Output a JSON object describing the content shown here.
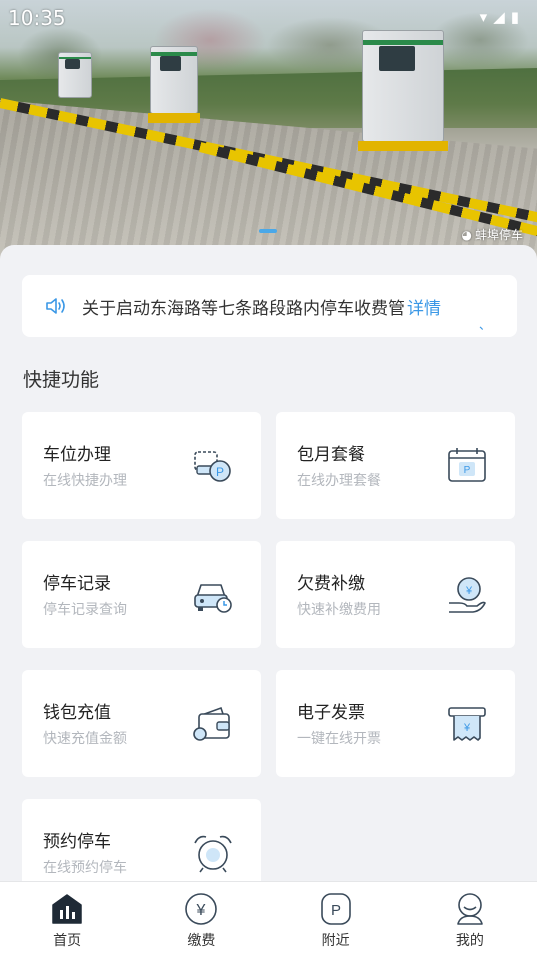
{
  "status_bar": {
    "time": "10:35",
    "icons": [
      "wifi-icon",
      "signal-icon",
      "battery-icon"
    ]
  },
  "banner": {
    "watermark": "蚌埠停车",
    "watermark_icon": "wechat-icon"
  },
  "notice": {
    "icon": "speaker-icon",
    "text": "关于启动东海路等七条路段路内停车收费管",
    "detail_label": "详情",
    "arrow": "、"
  },
  "quick_functions": {
    "title": "快捷功能",
    "items": [
      {
        "title": "车位办理",
        "subtitle": "在线快捷办理",
        "icon": "parking-space-icon"
      },
      {
        "title": "包月套餐",
        "subtitle": "在线办理套餐",
        "icon": "calendar-parking-icon"
      },
      {
        "title": "停车记录",
        "subtitle": "停车记录查询",
        "icon": "car-clock-icon"
      },
      {
        "title": "欠费补缴",
        "subtitle": "快速补缴费用",
        "icon": "hand-coin-icon"
      },
      {
        "title": "钱包充值",
        "subtitle": "快速充值金额",
        "icon": "wallet-icon"
      },
      {
        "title": "电子发票",
        "subtitle": "一键在线开票",
        "icon": "invoice-icon"
      },
      {
        "title": "预约停车",
        "subtitle": "在线预约停车",
        "icon": "alarm-clock-icon"
      }
    ]
  },
  "tabbar": {
    "items": [
      {
        "label": "首页",
        "icon": "home-chart-icon"
      },
      {
        "label": "缴费",
        "icon": "yuan-icon"
      },
      {
        "label": "附近",
        "icon": "parking-p-icon"
      },
      {
        "label": "我的",
        "icon": "user-icon"
      }
    ]
  },
  "colors": {
    "accent": "#3b98e6",
    "panel_bg": "#f1f2f5",
    "subtitle": "#b3b7bd"
  }
}
